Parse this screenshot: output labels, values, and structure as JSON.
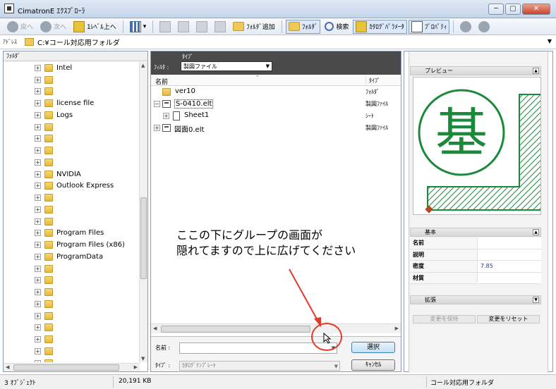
{
  "window": {
    "title": "CimatronE ｴｸｽﾌﾟﾛｰﾗ",
    "buttons": {
      "minimize": "─",
      "maximize": "▢",
      "close": "✕"
    }
  },
  "toolbar": {
    "back": "戻へ",
    "forward": "次へ",
    "up_level": "1ﾚﾍﾞﾙ上へ",
    "new_folder": "ﾌｫﾙﾀﾞ追加",
    "folders": "ﾌｫﾙﾀﾞ",
    "search": "検索",
    "catalog_params": "ｶﾀﾛｸﾞﾊﾟﾗﾒｰﾀ",
    "properties": "ﾌﾟﾛﾊﾟﾃｨ"
  },
  "address": {
    "label": "ｱﾄﾞﾚｽ",
    "path": "C:¥コール対応用フォルダ"
  },
  "tree": {
    "header": "ﾌｫﾙﾀﾞ",
    "items": [
      "Intel",
      "",
      "",
      "license file",
      "Logs",
      "",
      "",
      "",
      "",
      "NVIDIA",
      "Outlook Express",
      "",
      "",
      "",
      "Program Files",
      "Program Files (x86)",
      "ProgramData",
      "",
      "",
      "",
      "",
      "",
      "",
      "",
      "",
      ""
    ]
  },
  "middle": {
    "filter_label": "ﾌｨﾙﾀ :",
    "type_label": "ﾀｲﾌﾟ",
    "type_value": "製図ファイル",
    "col_name": "名前",
    "col_type": "ﾀｲﾌﾟ",
    "rows": [
      {
        "name": "ver10",
        "type": "ﾌｫﾙﾀﾞ"
      },
      {
        "name": "S-0410.elt",
        "type": "製図ﾌｧｲﾙ"
      },
      {
        "name": "Sheet1",
        "type": "ｼｰﾄ"
      },
      {
        "name": "図面0.elt",
        "type": "製図ﾌｧｲﾙ"
      }
    ],
    "note": "ここの下にグループの画面が\n隠れてますので上に広げてください",
    "name_label": "名前 :",
    "type_field_label": "ﾀｲﾌﾟ :",
    "type_field_value": "ｶﾀﾛｸﾞﾃﾝﾌﾟﾚｰﾄ",
    "select_button": "選択",
    "cancel_button": "ｷｬﾝｾﾙ"
  },
  "right": {
    "preview_title": "プレビュー",
    "preview_glyph": "基",
    "basic_title": "基本",
    "props": [
      {
        "key": "名前",
        "value": ""
      },
      {
        "key": "説明",
        "value": ""
      },
      {
        "key": "密度",
        "value": "7.85"
      },
      {
        "key": "材質",
        "value": ""
      }
    ],
    "ext_title": "拡張",
    "keep_changes": "変更を保持",
    "reset_changes": "変更をリセット"
  },
  "status": {
    "objects": "3 ｵﾌﾞｼﾞｪｸﾄ",
    "size": "20,191 KB",
    "folder": "コール対応用フォルダ"
  },
  "colors": {
    "annotation": "#e23a2a",
    "preview_green": "#1a8a3a"
  }
}
